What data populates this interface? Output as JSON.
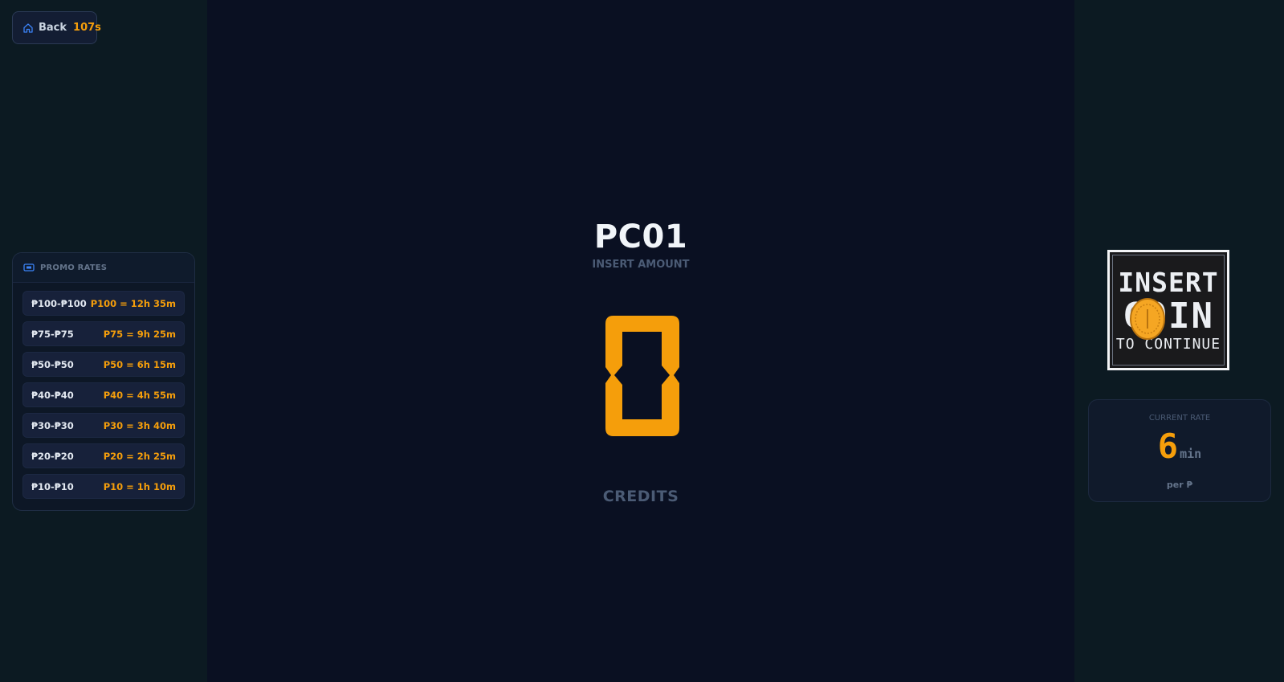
{
  "back_button": {
    "label": "Back",
    "countdown": "107s"
  },
  "promo": {
    "title": "PROMO RATES",
    "items": [
      {
        "range": "₱100-₱100",
        "rate": "P100 = 12h 35m"
      },
      {
        "range": "₱75-₱75",
        "rate": "P75 = 9h 25m"
      },
      {
        "range": "₱50-₱50",
        "rate": "P50 = 6h 15m"
      },
      {
        "range": "₱40-₱40",
        "rate": "P40 = 4h 55m"
      },
      {
        "range": "₱30-₱30",
        "rate": "P30 = 3h 40m"
      },
      {
        "range": "₱20-₱20",
        "rate": "P20 = 2h 25m"
      },
      {
        "range": "₱10-₱10",
        "rate": "P10 = 1h 10m"
      }
    ]
  },
  "main": {
    "pc_name": "PC01",
    "subtitle": "INSERT AMOUNT",
    "credits_value": "0",
    "credits_label": "CREDITS"
  },
  "insert_coin": {
    "line1": "INSERT",
    "line2": "COIN",
    "line3": "TO CONTINUE"
  },
  "current_rate": {
    "title": "CURRENT RATE",
    "value": "6",
    "unit": "min",
    "per": "per ₱"
  },
  "colors": {
    "accent": "#f59e0b",
    "background": "#0a1022",
    "side": "#0c1a22"
  }
}
